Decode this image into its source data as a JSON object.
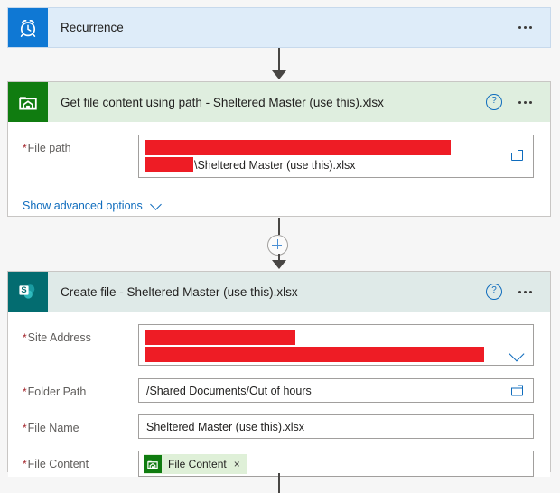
{
  "flow": {
    "trigger": {
      "title": "Recurrence",
      "icon": "alarm-clock-icon",
      "icon_color": "#0f78d4",
      "body_color": "#deecf9",
      "menu": "..."
    },
    "actions": [
      {
        "id": "get-file-content",
        "title": "Get file content using path - Sheltered Master (use this).xlsx",
        "icon": "onedrive-folder-icon",
        "icon_color": "#107c10",
        "header_color": "#dfeedf",
        "help": "?",
        "menu": "...",
        "fields": [
          {
            "label": "File path",
            "required": "*",
            "line1_redacted": true,
            "line2_redacted": true,
            "line2_text": "\\Sheltered Master (use this).xlsx",
            "trailing_icon": "folder-picker-icon"
          }
        ],
        "advanced_options": {
          "label": "Show advanced options",
          "icon": "chevron-down-icon"
        }
      },
      {
        "id": "create-file",
        "title": "Create file - Sheltered Master (use this).xlsx",
        "icon": "sharepoint-icon",
        "icon_color": "#036c70",
        "header_color": "#dfeae8",
        "help": "?",
        "menu": "...",
        "fields": [
          {
            "label": "Site Address",
            "required": "*",
            "line1_redacted": true,
            "line2_redacted": true,
            "trailing_icon": "chevron-down-icon"
          },
          {
            "label": "Folder Path",
            "required": "*",
            "value": "/Shared Documents/Out of hours",
            "trailing_icon": "folder-picker-icon"
          },
          {
            "label": "File Name",
            "required": "*",
            "value": "Sheltered Master (use this).xlsx"
          },
          {
            "label": "File Content",
            "required": "*",
            "token": {
              "label": "File Content",
              "icon": "onedrive-folder-icon",
              "remove": "×"
            }
          }
        ]
      }
    ],
    "connectors": {
      "insert_button": "+",
      "arrow": "arrow-down-icon"
    }
  },
  "colors": {
    "redaction": "#ee1c25",
    "link": "#0f6cbd",
    "required": "#a4262c",
    "canvas": "#f6f6f6"
  }
}
